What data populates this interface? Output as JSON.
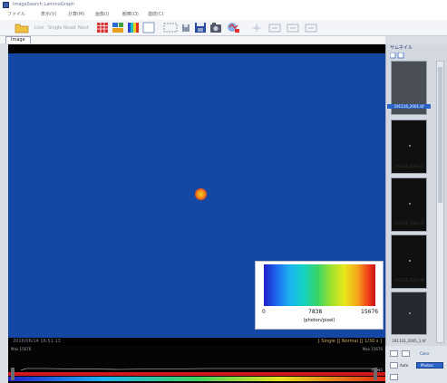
{
  "window": {
    "title": "ImageSearch LaminoGraph"
  },
  "menu": [
    "ファイル",
    "表示(V)",
    "計算(M)",
    "画像(I)",
    "観察(O)",
    "連続(C)"
  ],
  "toolbar": {
    "text_buttons": [
      "Live",
      "Single",
      "Reset",
      "Next"
    ]
  },
  "tabs": [
    "Image"
  ],
  "image_view": {
    "colorbar": {
      "min": "0",
      "mid": "7838",
      "max": "15676",
      "unit": "(photon/pixel)"
    },
    "status_left": "2016/06/14 16:51:13",
    "status_right": "[ Single ][ Normal ][ 1/30 s ]"
  },
  "histogram": {
    "max_label": "Max 15676",
    "low_label": "25616",
    "top_right_label": "Max 15676"
  },
  "thumbnails": {
    "title": "サムネイル",
    "items": [
      {
        "label": "191116_2001.tif"
      },
      {
        "label": "191116_2002.tif"
      },
      {
        "label": "191116_2003.tif"
      },
      {
        "label": "191116_2004.tif"
      },
      {
        "label": "191116_2005_1.tif"
      }
    ]
  },
  "bottom_right": {
    "color_label": "Color",
    "auto_label": "Auto",
    "photon_label": "Photon"
  },
  "colors": {
    "image_bg": "#1448a4",
    "selection": "#2a64c8",
    "accent": "#d63c18"
  }
}
